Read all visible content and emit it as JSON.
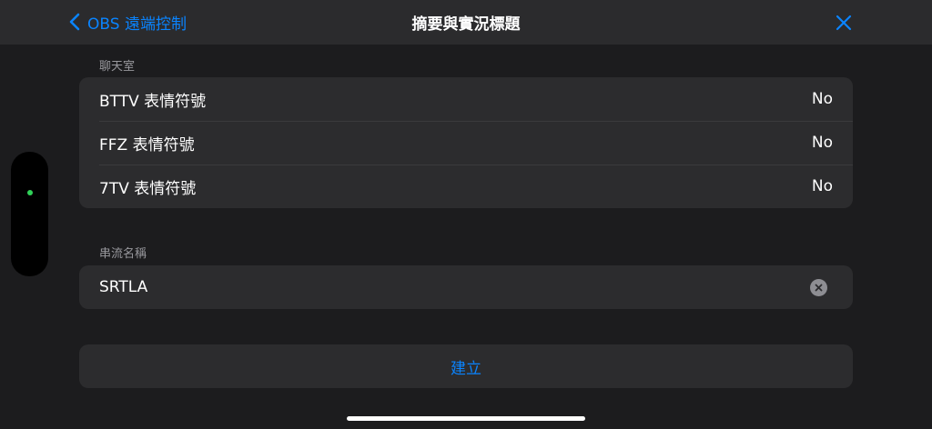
{
  "nav": {
    "back_label": "OBS 遠端控制",
    "title": "摘要與實況標題"
  },
  "chat_section": {
    "header": "聊天室",
    "rows": [
      {
        "label": "BTTV 表情符號",
        "value": "No"
      },
      {
        "label": "FFZ 表情符號",
        "value": "No"
      },
      {
        "label": "7TV 表情符號",
        "value": "No"
      }
    ]
  },
  "stream_section": {
    "header": "串流名稱",
    "input_value": "SRTLA"
  },
  "create_button": {
    "label": "建立"
  },
  "colors": {
    "accent": "#0a84ff",
    "status_dot": "#30d158",
    "background": "#1c1c1e",
    "cell": "#2c2c2e"
  },
  "icons": {
    "back": "chevron-left-icon",
    "close": "close-icon",
    "clear": "clear-circle-icon"
  }
}
